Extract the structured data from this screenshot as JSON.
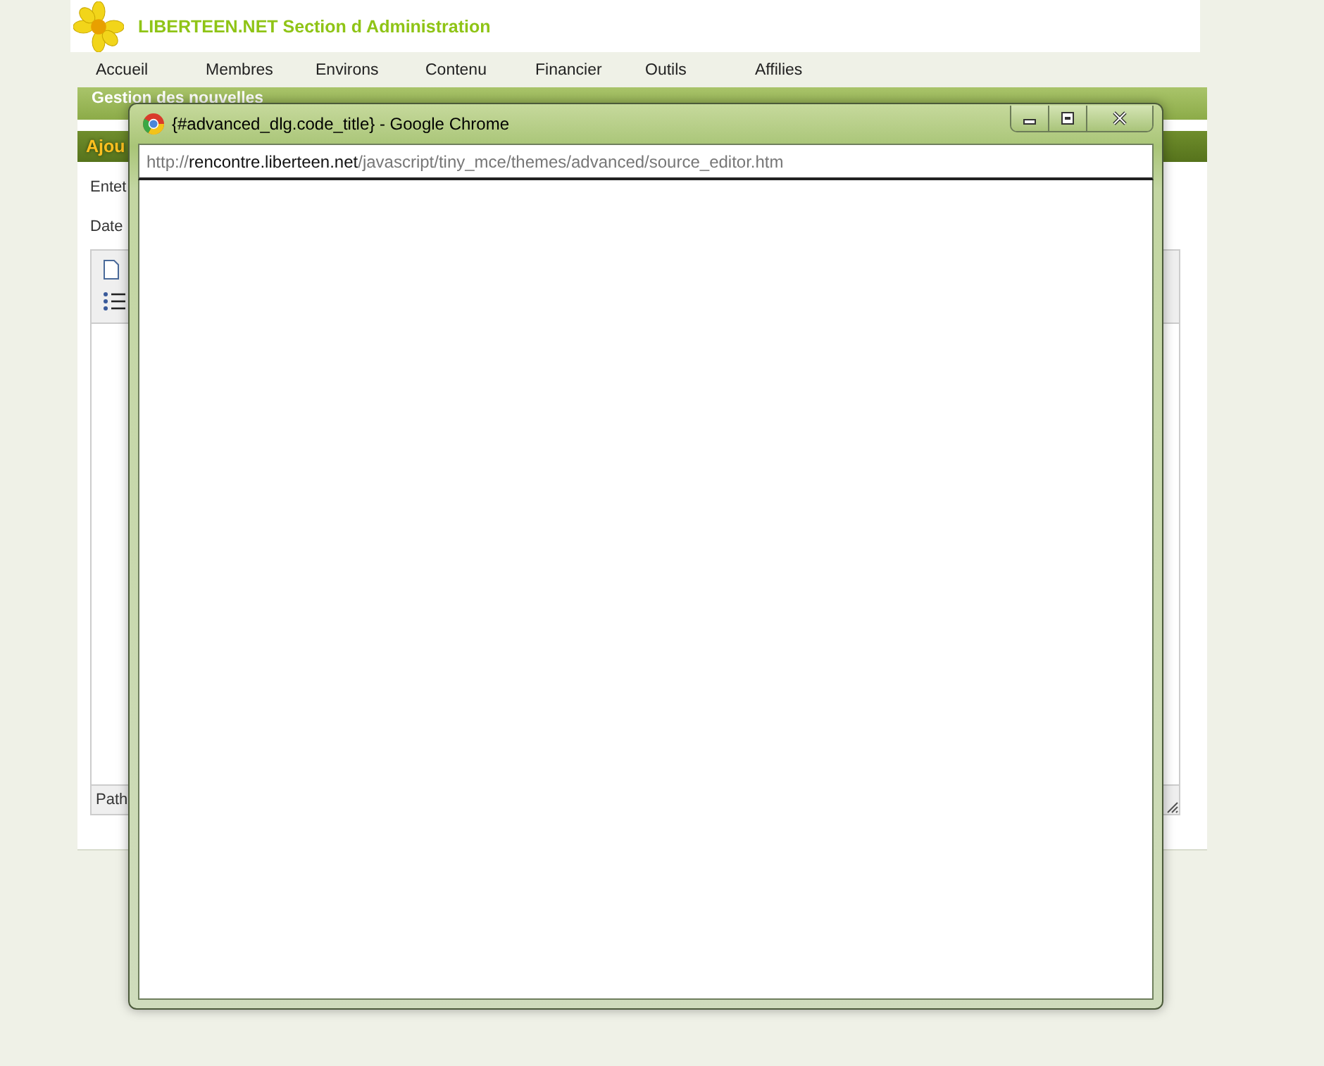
{
  "header": {
    "title": "LIBERTEEN.NET Section d Administration"
  },
  "nav": [
    "Accueil",
    "Membres",
    "Environs",
    "Contenu",
    "Financier",
    "Outils",
    "Affilies"
  ],
  "section_bar": {
    "title": "Gestion des nouvelles"
  },
  "subsection_bar": {
    "title": "Ajou"
  },
  "form": {
    "labels": [
      "Entet",
      "Date"
    ],
    "editor_status": "Path"
  },
  "popup": {
    "title": "{#advanced_dlg.code_title} - Google Chrome",
    "address": {
      "scheme": "http://",
      "host": "rencontre.liberteen.net",
      "path": "/javascript/tiny_mce/themes/advanced/source_editor.htm"
    }
  }
}
